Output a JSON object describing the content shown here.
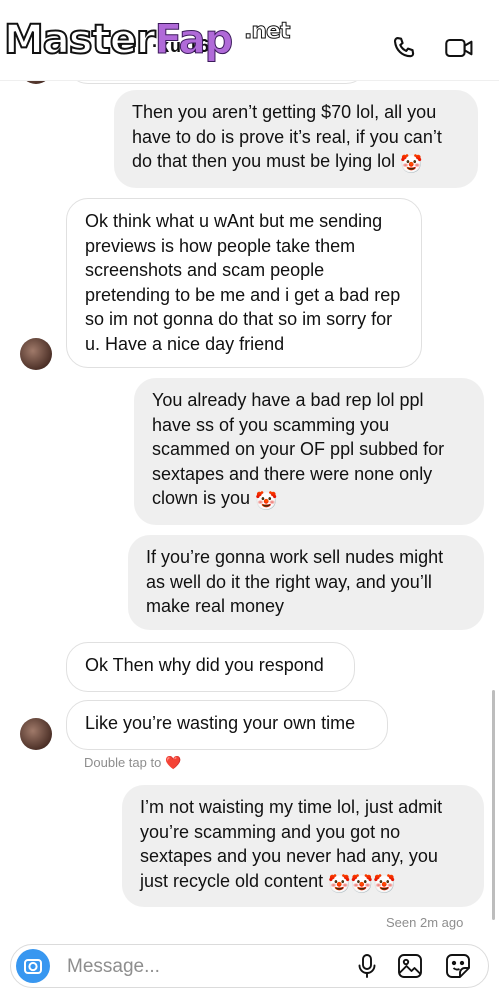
{
  "watermark": {
    "part1": "Master",
    "part2": "Fap",
    "net": ".net"
  },
  "header": {
    "username": "r ·· ·ku 16",
    "call_icon": "phone-icon",
    "video_icon": "video-camera-icon"
  },
  "messages": [
    {
      "side": "out",
      "text": "Then you aren’t getting $70 lol, all you have to do is prove it’s real, if you can’t do that then you must be lying lol",
      "emojis": [
        "🤡"
      ]
    },
    {
      "side": "in",
      "text": "Ok think what u wAnt but me sending previews is how people take them screenshots and scam people pretending to be me and i get a bad rep so im not gonna do that so im sorry for u. Have a nice day friend"
    },
    {
      "side": "out",
      "text": "You already have a bad rep lol ppl have ss of you scamming you scammed on your OF ppl subbed for sextapes and there were none only clown is you",
      "emojis": [
        "🤡"
      ]
    },
    {
      "side": "out",
      "text": "If you’re gonna work sell nudes might as well do it the right way, and you’ll make real money"
    },
    {
      "side": "in",
      "text": "Ok Then why did you respond"
    },
    {
      "side": "in",
      "text": "Like you’re wasting your own time"
    },
    {
      "side": "out",
      "text": "I’m not waisting my time lol, just admit you’re scamming and you got no sextapes and you never had any, you just recycle old content",
      "emojis": [
        "🤡",
        "🤡",
        "🤡"
      ]
    }
  ],
  "double_tap": {
    "text": "Double tap to",
    "icon": "heart-icon",
    "heart": "❤️"
  },
  "seen": "Seen 2m ago",
  "composer": {
    "placeholder": "Message...",
    "camera_icon": "camera-icon",
    "mic_icon": "microphone-icon",
    "gallery_icon": "gallery-icon",
    "sticker_icon": "sticker-icon"
  },
  "colors": {
    "accent": "#3897f0",
    "outgoing_bubble": "#efefef",
    "incoming_border": "#e0e0e0",
    "meta_text": "#8e8e8e"
  }
}
